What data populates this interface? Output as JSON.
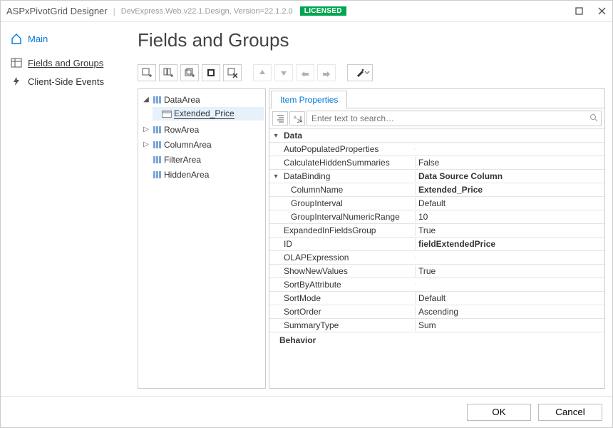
{
  "header": {
    "title": "ASPxPivotGrid Designer",
    "subtitle": "DevExpress.Web.v22.1.Design, Version=22.1.2.0",
    "badge": "LICENSED"
  },
  "sidebar": {
    "main": "Main",
    "items": [
      {
        "label": "Fields and Groups"
      },
      {
        "label": "Client-Side Events"
      }
    ]
  },
  "page_title": "Fields and Groups",
  "toolbar_buttons": [
    "add-field",
    "add-area",
    "add-group",
    "edit-field",
    "delete-field",
    "move-up",
    "move-down",
    "move-left",
    "move-right",
    "wizard"
  ],
  "tree": {
    "items": [
      {
        "label": "DataArea",
        "expanded": true,
        "children": [
          {
            "label": "Extended_Price",
            "selected": true
          }
        ]
      },
      {
        "label": "RowArea",
        "expanded": false
      },
      {
        "label": "ColumnArea",
        "expanded": false
      },
      {
        "label": "FilterArea",
        "leaf": true
      },
      {
        "label": "HiddenArea",
        "leaf": true
      }
    ]
  },
  "tab": "Item Properties",
  "search_placeholder": "Enter text to search…",
  "properties": {
    "categories": [
      {
        "name": "Data",
        "expanded": true,
        "rows": [
          {
            "name": "AutoPopulatedProperties",
            "value": ""
          },
          {
            "name": "CalculateHiddenSummaries",
            "value": "False"
          },
          {
            "name": "DataBinding",
            "value": "Data Source Column",
            "bold": true,
            "expandable": true,
            "expanded": true,
            "children": [
              {
                "name": "ColumnName",
                "value": "Extended_Price",
                "bold": true
              },
              {
                "name": "GroupInterval",
                "value": "Default"
              },
              {
                "name": "GroupIntervalNumericRange",
                "value": "10"
              }
            ]
          },
          {
            "name": "ExpandedInFieldsGroup",
            "value": "True"
          },
          {
            "name": "ID",
            "value": "fieldExtendedPrice",
            "bold": true
          },
          {
            "name": "OLAPExpression",
            "value": ""
          },
          {
            "name": "ShowNewValues",
            "value": "True"
          },
          {
            "name": "SortByAttribute",
            "value": ""
          },
          {
            "name": "SortMode",
            "value": "Default"
          },
          {
            "name": "SortOrder",
            "value": "Ascending"
          },
          {
            "name": "SummaryType",
            "value": "Sum"
          }
        ]
      }
    ],
    "next_category": "Behavior"
  },
  "footer": {
    "ok": "OK",
    "cancel": "Cancel"
  }
}
